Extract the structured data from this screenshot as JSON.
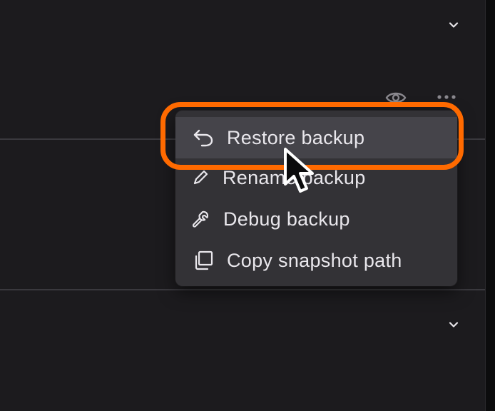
{
  "menu": {
    "items": [
      {
        "label": "Restore backup",
        "icon": "undo-arrow-icon",
        "active": true
      },
      {
        "label": "Rename backup",
        "icon": "pencil-icon",
        "active": false
      },
      {
        "label": "Debug backup",
        "icon": "wrench-icon",
        "active": false
      },
      {
        "label": "Copy snapshot path",
        "icon": "copy-icon",
        "active": false
      }
    ]
  },
  "colors": {
    "background": "#1c1b1e",
    "menu_background": "#333236",
    "menu_active": "#45444a",
    "highlight": "#ff6a00",
    "text": "#e9e7ec"
  },
  "icons": {
    "top_chevron": "chevron-down-icon",
    "bottom_chevron": "chevron-down-icon",
    "row_eye": "eye-icon",
    "row_more": "more-dots-icon"
  }
}
